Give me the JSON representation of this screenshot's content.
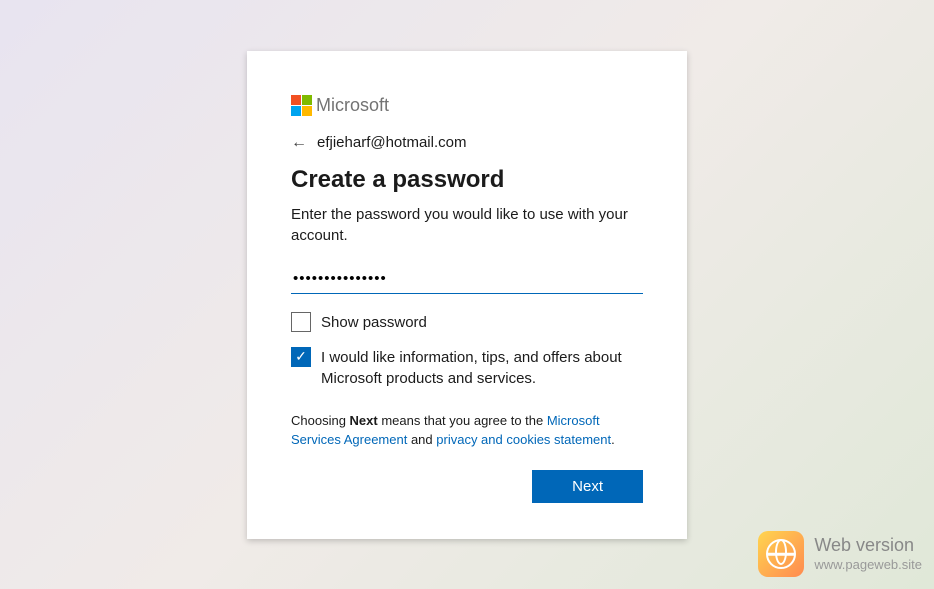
{
  "brand": "Microsoft",
  "account_email": "efjieharf@hotmail.com",
  "heading": "Create a password",
  "subtext": "Enter the password you would like to use with your account.",
  "password_value": "•••••••••••••••",
  "show_password_label": "Show password",
  "show_password_checked": false,
  "offers_label": "I would like information, tips, and offers about Microsoft products and services.",
  "offers_checked": true,
  "legal": {
    "pre": "Choosing ",
    "bold": "Next",
    "mid": " means that you agree to the ",
    "link1": "Microsoft Services Agreement",
    "and": " and ",
    "link2": "privacy and cookies statement",
    "end": "."
  },
  "next_button": "Next",
  "watermark": {
    "title": "Web version",
    "url": "www.pageweb.site"
  }
}
